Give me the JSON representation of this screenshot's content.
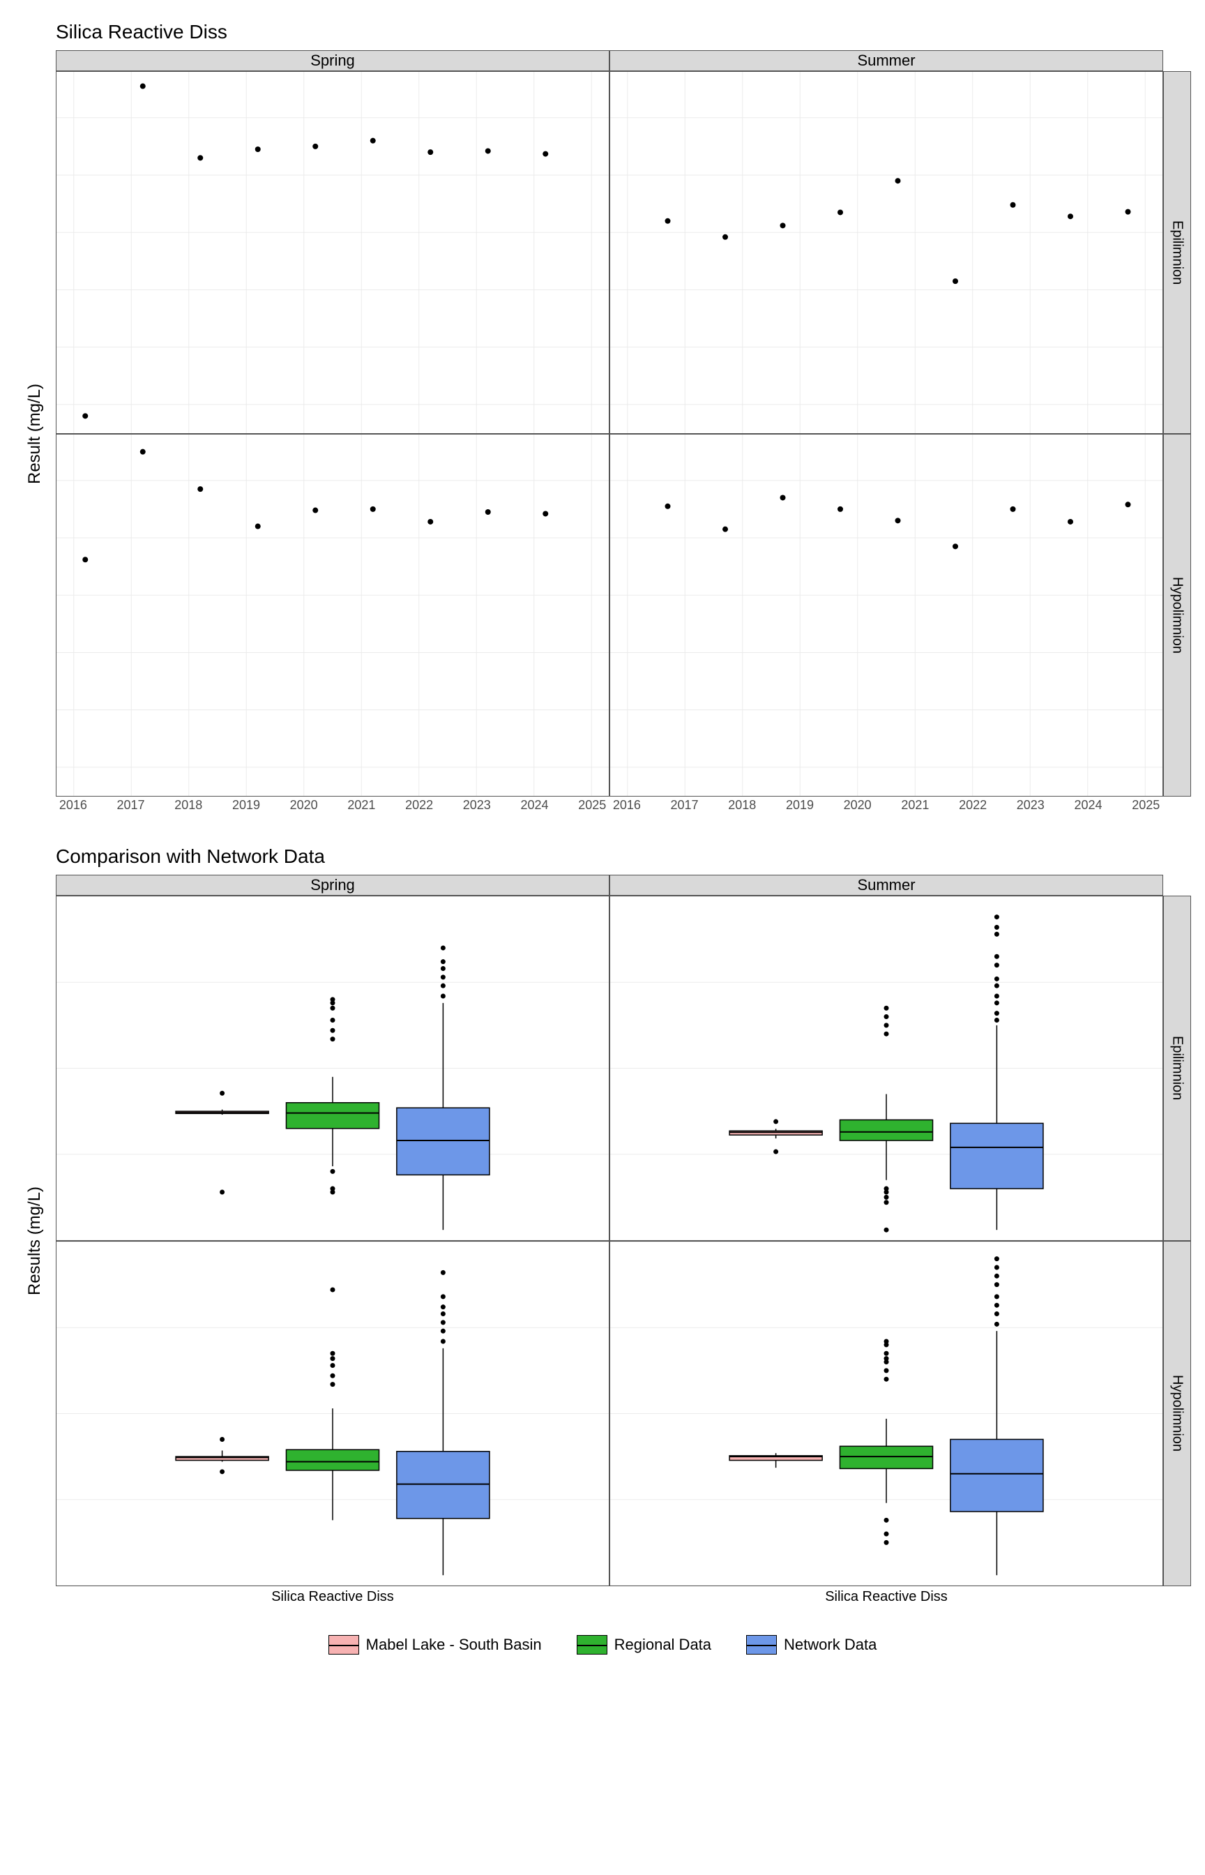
{
  "chart_data": [
    {
      "type": "scatter",
      "title": "Silica Reactive Diss",
      "ylabel": "Result (mg/L)",
      "ylim": [
        2.5,
        8.8
      ],
      "x_ticks": [
        2016,
        2017,
        2018,
        2019,
        2020,
        2021,
        2022,
        2023,
        2024,
        2025
      ],
      "facets": {
        "cols": [
          "Spring",
          "Summer"
        ],
        "rows": [
          "Epilimnion",
          "Hypolimnion"
        ]
      },
      "panels": {
        "Spring_Epilimnion": {
          "x": [
            2016.2,
            2017.2,
            2018.2,
            2019.2,
            2020.2,
            2021.2,
            2022.2,
            2023.2,
            2024.2
          ],
          "y": [
            2.8,
            8.55,
            7.3,
            7.45,
            7.5,
            7.6,
            7.4,
            7.42,
            7.37
          ]
        },
        "Summer_Epilimnion": {
          "x": [
            2016.7,
            2017.7,
            2018.7,
            2019.7,
            2020.7,
            2021.7,
            2022.7,
            2023.7,
            2024.7
          ],
          "y": [
            6.2,
            5.92,
            6.12,
            6.35,
            6.9,
            5.15,
            6.48,
            6.28,
            6.36
          ]
        },
        "Spring_Hypolimnion": {
          "x": [
            2016.2,
            2017.2,
            2018.2,
            2019.2,
            2020.2,
            2021.2,
            2022.2,
            2023.2,
            2024.2
          ],
          "y": [
            6.62,
            8.5,
            7.85,
            7.2,
            7.48,
            7.5,
            7.28,
            7.45,
            7.42
          ]
        },
        "Summer_Hypolimnion": {
          "x": [
            2016.7,
            2017.7,
            2018.7,
            2019.7,
            2020.7,
            2021.7,
            2022.7,
            2023.7,
            2024.7
          ],
          "y": [
            7.55,
            7.15,
            7.7,
            7.5,
            7.3,
            6.85,
            7.5,
            7.28,
            7.58
          ]
        }
      }
    },
    {
      "type": "boxplot",
      "title": "Comparison with Network Data",
      "ylabel": "Results (mg/L)",
      "ylim": [
        0,
        20
      ],
      "x_category": "Silica Reactive Diss",
      "facets": {
        "cols": [
          "Spring",
          "Summer"
        ],
        "rows": [
          "Epilimnion",
          "Hypolimnion"
        ]
      },
      "legend": [
        {
          "name": "Mabel Lake - South Basin",
          "color": "#f7b2b2"
        },
        {
          "name": "Regional Data",
          "color": "#2fb22f"
        },
        {
          "name": "Network Data",
          "color": "#6d97e8"
        }
      ],
      "panels": {
        "Spring_Epilimnion": {
          "boxes": [
            {
              "series": "Mabel Lake - South Basin",
              "min": 7.3,
              "q1": 7.37,
              "median": 7.42,
              "q3": 7.5,
              "max": 7.6,
              "outliers": [
                2.8,
                8.55
              ]
            },
            {
              "series": "Regional Data",
              "min": 4.3,
              "q1": 6.5,
              "median": 7.4,
              "q3": 8.0,
              "max": 9.5,
              "outliers": [
                2.8,
                3.0,
                4.0,
                11.7,
                12.2,
                12.8,
                13.5,
                13.8,
                14.0
              ]
            },
            {
              "series": "Network Data",
              "min": 0.6,
              "q1": 3.8,
              "median": 5.8,
              "q3": 7.7,
              "max": 13.8,
              "outliers": [
                14.2,
                14.8,
                15.3,
                15.8,
                16.2,
                17.0
              ]
            }
          ]
        },
        "Summer_Epilimnion": {
          "boxes": [
            {
              "series": "Mabel Lake - South Basin",
              "min": 5.92,
              "q1": 6.12,
              "median": 6.28,
              "q3": 6.36,
              "max": 6.48,
              "outliers": [
                5.15,
                6.9
              ]
            },
            {
              "series": "Regional Data",
              "min": 3.5,
              "q1": 5.8,
              "median": 6.3,
              "q3": 7.0,
              "max": 8.5,
              "outliers": [
                0.6,
                2.2,
                2.5,
                2.8,
                3.0,
                12.0,
                12.5,
                13.0,
                13.5
              ]
            },
            {
              "series": "Network Data",
              "min": 0.6,
              "q1": 3.0,
              "median": 5.4,
              "q3": 6.8,
              "max": 12.5,
              "outliers": [
                12.8,
                13.2,
                13.8,
                14.2,
                14.8,
                15.2,
                16.0,
                16.5,
                17.8,
                18.2,
                18.8
              ]
            }
          ]
        },
        "Spring_Hypolimnion": {
          "boxes": [
            {
              "series": "Mabel Lake - South Basin",
              "min": 7.2,
              "q1": 7.28,
              "median": 7.45,
              "q3": 7.5,
              "max": 7.85,
              "outliers": [
                6.62,
                8.5
              ]
            },
            {
              "series": "Regional Data",
              "min": 3.8,
              "q1": 6.7,
              "median": 7.2,
              "q3": 7.9,
              "max": 10.3,
              "outliers": [
                11.7,
                12.2,
                12.8,
                13.2,
                13.5,
                17.2
              ]
            },
            {
              "series": "Network Data",
              "min": 0.6,
              "q1": 3.9,
              "median": 5.9,
              "q3": 7.8,
              "max": 13.8,
              "outliers": [
                14.2,
                14.8,
                15.3,
                15.8,
                16.2,
                16.8,
                18.2
              ]
            }
          ]
        },
        "Summer_Hypolimnion": {
          "boxes": [
            {
              "series": "Mabel Lake - South Basin",
              "min": 6.85,
              "q1": 7.28,
              "median": 7.5,
              "q3": 7.55,
              "max": 7.7,
              "outliers": []
            },
            {
              "series": "Regional Data",
              "min": 4.8,
              "q1": 6.8,
              "median": 7.5,
              "q3": 8.1,
              "max": 9.7,
              "outliers": [
                2.5,
                3.0,
                3.8,
                12.0,
                12.5,
                13.0,
                13.2,
                13.5,
                14.0,
                14.2
              ]
            },
            {
              "series": "Network Data",
              "min": 0.6,
              "q1": 4.3,
              "median": 6.5,
              "q3": 8.5,
              "max": 14.8,
              "outliers": [
                15.2,
                15.8,
                16.3,
                16.8,
                17.5,
                18.0,
                18.5,
                19.0
              ]
            }
          ]
        }
      }
    }
  ]
}
